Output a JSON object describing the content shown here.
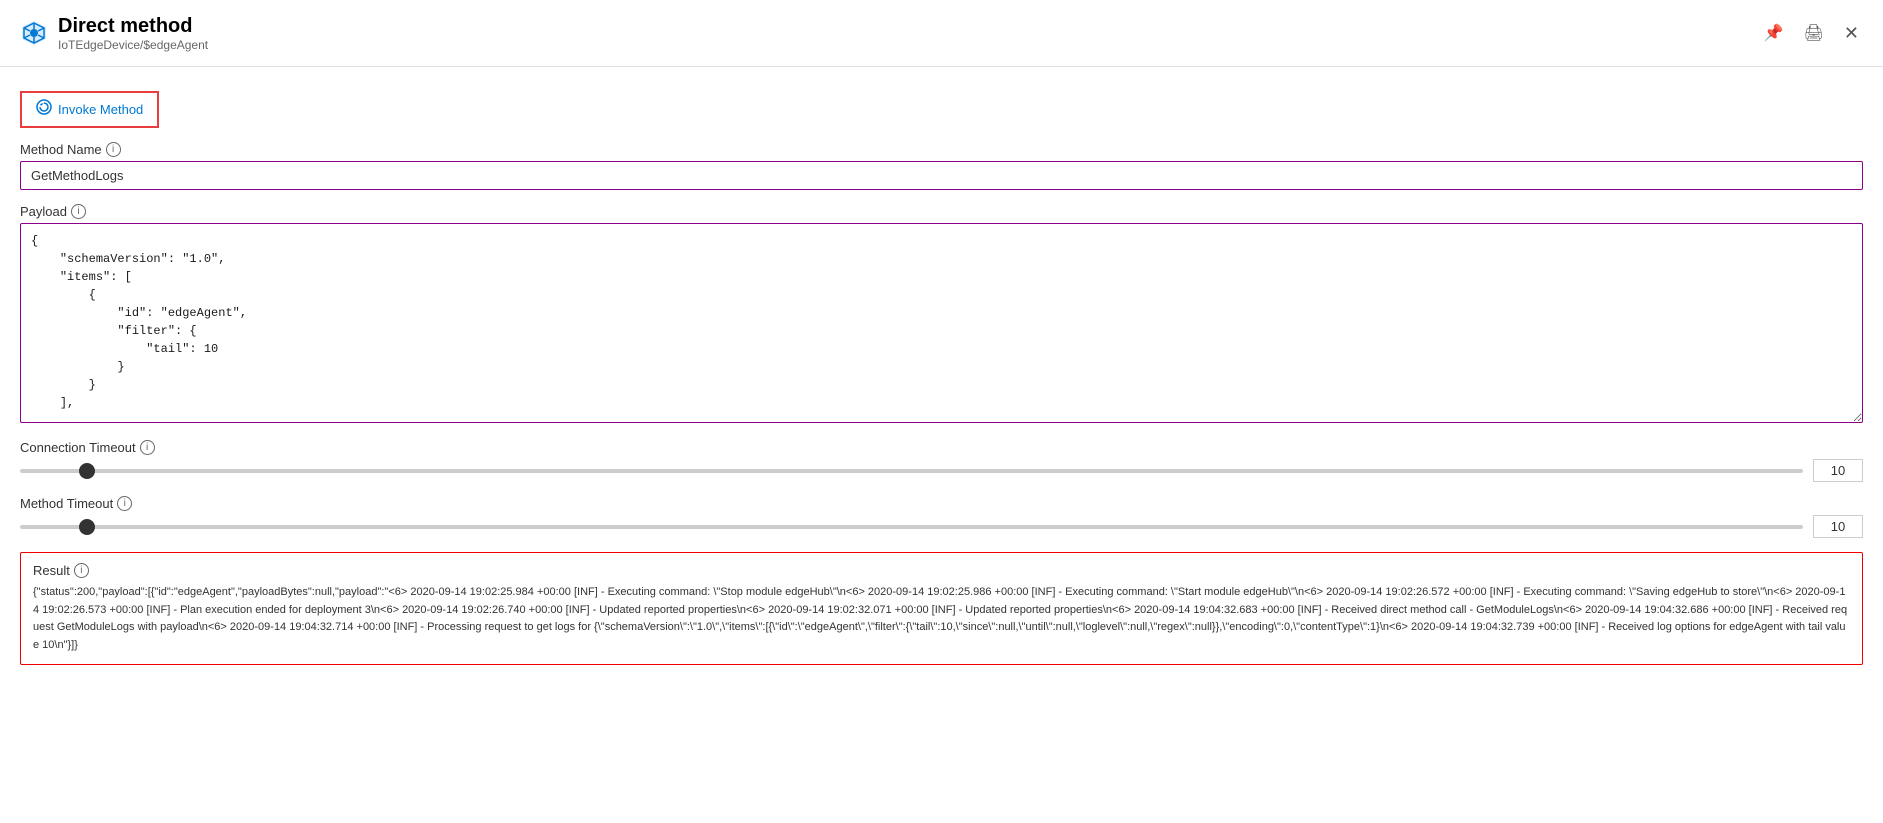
{
  "header": {
    "title": "Direct method",
    "subtitle": "IoTEdgeDevice/$edgeAgent",
    "pin_icon": "pin-icon",
    "print_icon": "print-icon",
    "close_icon": "close-icon"
  },
  "invoke_method": {
    "label": "Invoke Method"
  },
  "method_name": {
    "label": "Method Name",
    "value": "GetMethodLogs",
    "placeholder": ""
  },
  "payload": {
    "label": "Payload",
    "value": "{\n    \"schemaVersion\": \"1.0\",\n    \"items\": [\n        {\n            \"id\": \"edgeAgent\",\n            \"filter\": {\n                \"tail\": 10\n            }\n        }\n    ],"
  },
  "connection_timeout": {
    "label": "Connection Timeout",
    "value": 10,
    "min": 0,
    "max": 300
  },
  "method_timeout": {
    "label": "Method Timeout",
    "value": 10,
    "min": 0,
    "max": 300
  },
  "result": {
    "label": "Result",
    "value": "{\"status\":200,\"payload\":[{\"id\":\"edgeAgent\",\"payloadBytes\":null,\"payload\":\"<6> 2020-09-14 19:02:25.984 +00:00 [INF] - Executing command: \\\"Stop module edgeHub\\\"\\n<6> 2020-09-14 19:02:25.986 +00:00 [INF] - Executing command: \\\"Start module edgeHub\\\"\\n<6> 2020-09-14 19:02:26.572 +00:00 [INF] - Executing command: \\\"Saving edgeHub to store\\\"\\n<6> 2020-09-14 19:02:26.573 +00:00 [INF] - Plan execution ended for deployment 3\\n<6> 2020-09-14 19:02:26.740 +00:00 [INF] - Updated reported properties\\n<6> 2020-09-14 19:02:32.071 +00:00 [INF] - Updated reported properties\\n<6> 2020-09-14 19:04:32.683 +00:00 [INF] - Received direct method call - GetModuleLogs\\n<6> 2020-09-14 19:04:32.686 +00:00 [INF] - Received request GetModuleLogs with payload\\n<6> 2020-09-14 19:04:32.714 +00:00 [INF] - Processing request to get logs for {\\\"schemaVersion\\\":\\\"1.0\\\",\\\"items\\\":[{\\\"id\\\":\\\"edgeAgent\\\",\\\"filter\\\":{\\\"tail\\\":10,\\\"since\\\":null,\\\"until\\\":null,\\\"loglevel\\\":null,\\\"regex\\\":null}},\\\"encoding\\\":0,\\\"contentType\\\":1}\\n<6> 2020-09-14 19:04:32.739 +00:00 [INF] - Received log options for edgeAgent with tail value 10\\n\"}]}"
  }
}
